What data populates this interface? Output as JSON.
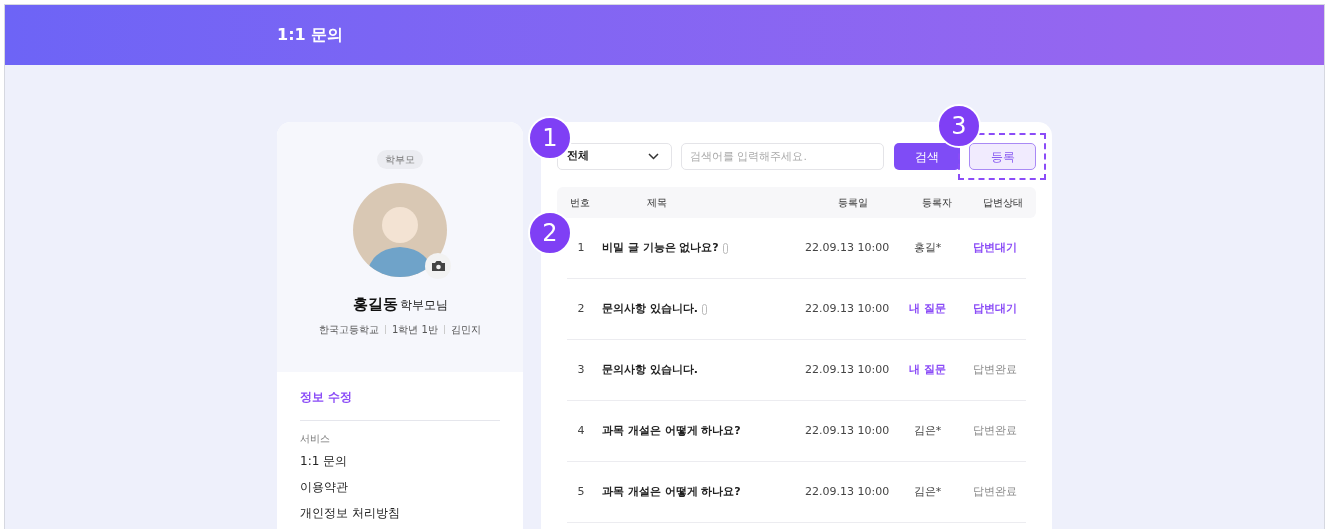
{
  "header": {
    "title": "1:1 문의"
  },
  "profile": {
    "role_badge": "학부모",
    "name": "홍길동",
    "name_suffix": "학부모님",
    "info": [
      "한국고등학교",
      "1학년 1반",
      "김민지"
    ]
  },
  "menu": {
    "edit_link": "정보 수정",
    "section_label": "서비스",
    "items": [
      "1:1 문의",
      "이용약관",
      "개인정보 처리방침"
    ]
  },
  "toolbar": {
    "filter": "전체",
    "search_placeholder": "검색어를 입력해주세요.",
    "search_button": "검색",
    "register_button": "등록"
  },
  "table": {
    "columns": [
      "번호",
      "제목",
      "등록일",
      "등록자",
      "답변상태"
    ],
    "rows": [
      {
        "no": "1",
        "title": "비밀 글 기능은 없나요?",
        "attachment": true,
        "date": "22.09.13 10:00",
        "author": "홍길*",
        "is_mine": false,
        "status": "답변대기",
        "pending": true
      },
      {
        "no": "2",
        "title": "문의사항 있습니다.",
        "attachment": true,
        "date": "22.09.13 10:00",
        "author": "내 질문",
        "is_mine": true,
        "status": "답변대기",
        "pending": true
      },
      {
        "no": "3",
        "title": "문의사항 있습니다.",
        "attachment": false,
        "date": "22.09.13 10:00",
        "author": "내 질문",
        "is_mine": true,
        "status": "답변완료",
        "pending": false
      },
      {
        "no": "4",
        "title": "과목 개설은 어떻게 하나요?",
        "attachment": false,
        "date": "22.09.13 10:00",
        "author": "김은*",
        "is_mine": false,
        "status": "답변완료",
        "pending": false
      },
      {
        "no": "5",
        "title": "과목 개설은 어떻게 하나요?",
        "attachment": false,
        "date": "22.09.13 10:00",
        "author": "김은*",
        "is_mine": false,
        "status": "답변완료",
        "pending": false
      }
    ]
  },
  "annotations": [
    "1",
    "2",
    "3"
  ]
}
